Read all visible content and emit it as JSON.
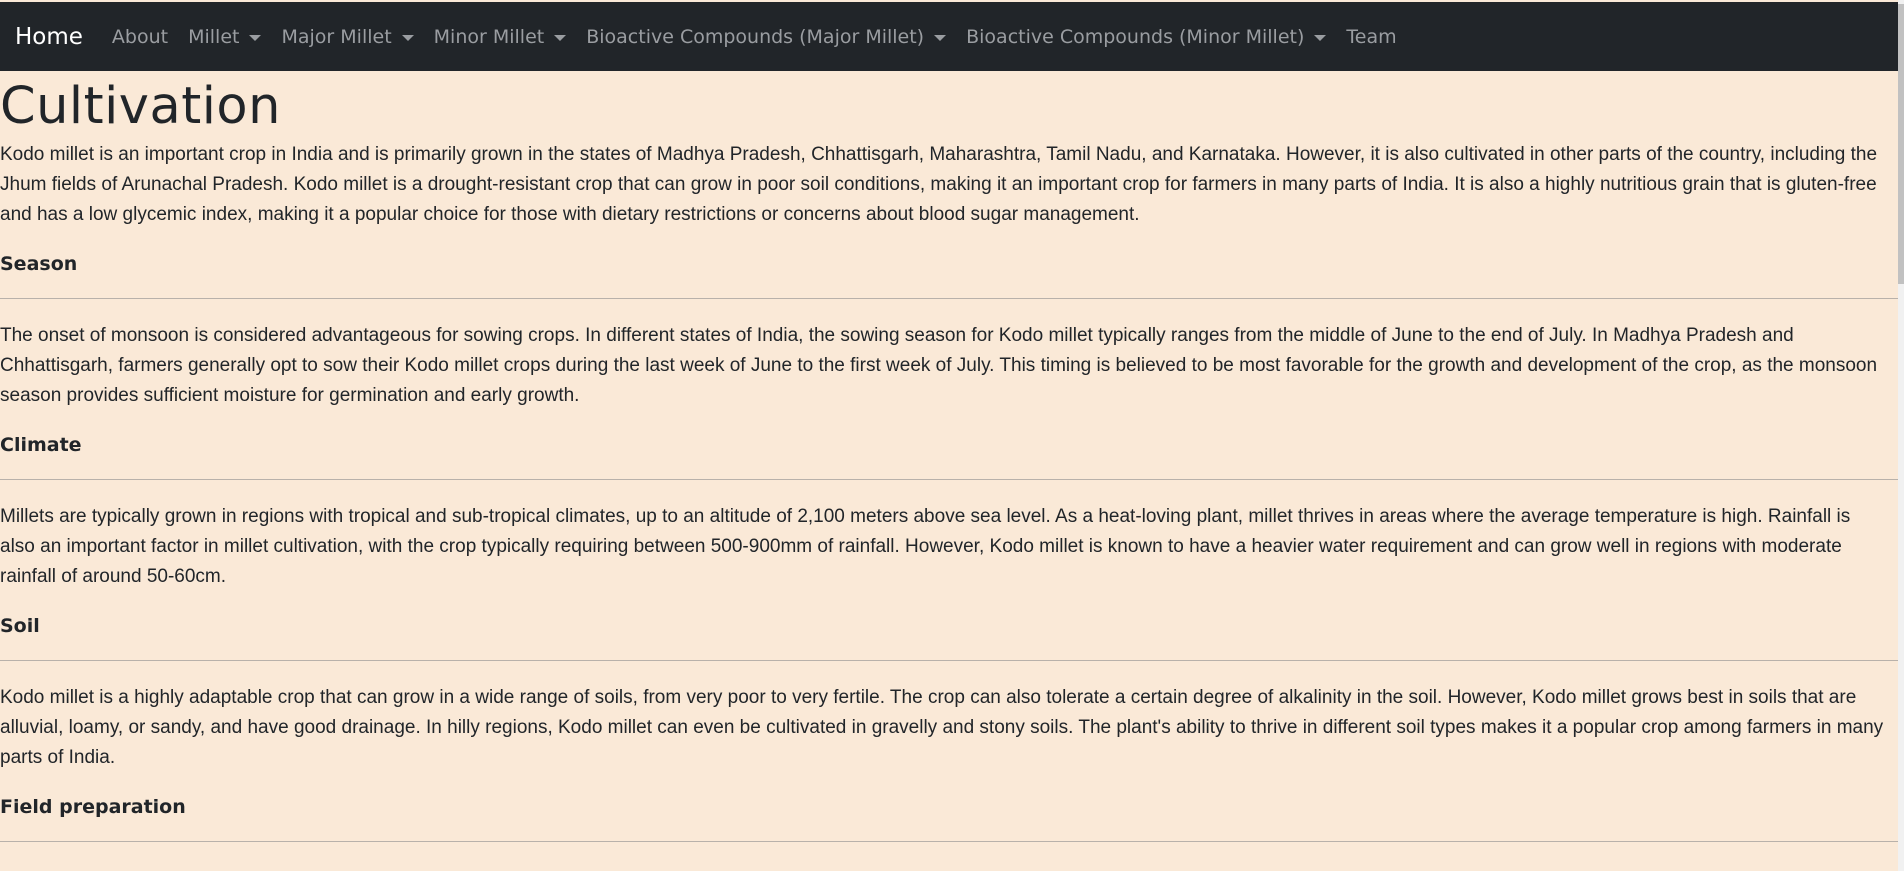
{
  "navbar": {
    "brand": "Home",
    "items": [
      {
        "label": "About",
        "dropdown": false
      },
      {
        "label": "Millet",
        "dropdown": true
      },
      {
        "label": "Major Millet",
        "dropdown": true
      },
      {
        "label": "Minor Millet",
        "dropdown": true
      },
      {
        "label": "Bioactive Compounds (Major Millet)",
        "dropdown": true
      },
      {
        "label": "Bioactive Compounds (Minor Millet)",
        "dropdown": true
      },
      {
        "label": "Team",
        "dropdown": false
      }
    ]
  },
  "page": {
    "title": "Cultivation",
    "intro": "Kodo millet is an important crop in India and is primarily grown in the states of Madhya Pradesh, Chhattisgarh, Maharashtra, Tamil Nadu, and Karnataka. However, it is also cultivated in other parts of the country, including the Jhum fields of Arunachal Pradesh. Kodo millet is a drought-resistant crop that can grow in poor soil conditions, making it an important crop for farmers in many parts of India. It is also a highly nutritious grain that is gluten-free and has a low glycemic index, making it a popular choice for those with dietary restrictions or concerns about blood sugar management.",
    "sections": [
      {
        "heading": "Season",
        "text": "The onset of monsoon is considered advantageous for sowing crops. In different states of India, the sowing season for Kodo millet typically ranges from the middle of June to the end of July. In Madhya Pradesh and Chhattisgarh, farmers generally opt to sow their Kodo millet crops during the last week of June to the first week of July. This timing is believed to be most favorable for the growth and development of the crop, as the monsoon season provides sufficient moisture for germination and early growth."
      },
      {
        "heading": "Climate",
        "text": "Millets are typically grown in regions with tropical and sub-tropical climates, up to an altitude of 2,100 meters above sea level. As a heat-loving plant, millet thrives in areas where the average temperature is high. Rainfall is also an important factor in millet cultivation, with the crop typically requiring between 500-900mm of rainfall. However, Kodo millet is known to have a heavier water requirement and can grow well in regions with moderate rainfall of around 50-60cm."
      },
      {
        "heading": "Soil",
        "text": "Kodo millet is a highly adaptable crop that can grow in a wide range of soils, from very poor to very fertile. The crop can also tolerate a certain degree of alkalinity in the soil. However, Kodo millet grows best in soils that are alluvial, loamy, or sandy, and have good drainage. In hilly regions, Kodo millet can even be cultivated in gravelly and stony soils. The plant's ability to thrive in different soil types makes it a popular crop among farmers in many parts of India."
      },
      {
        "heading": "Field preparation",
        "text": ""
      }
    ]
  }
}
